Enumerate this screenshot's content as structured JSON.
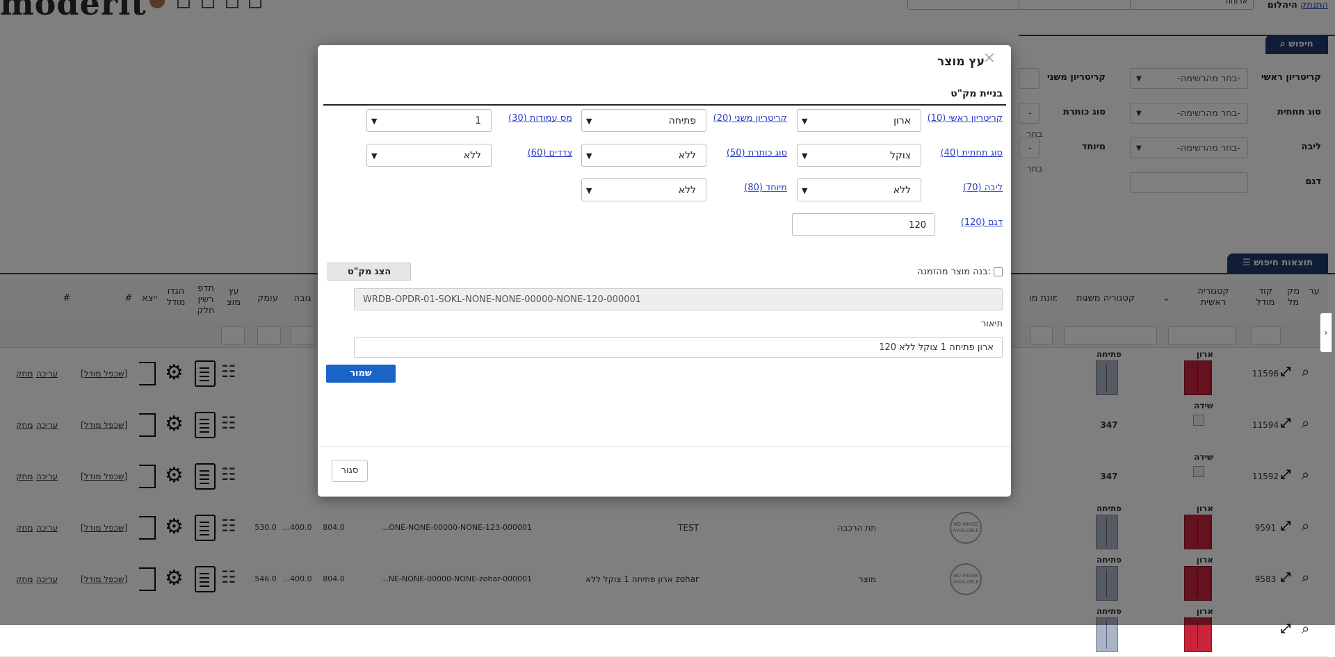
{
  "topbar": {
    "logo": "moderit",
    "links": [
      "היהלום",
      "התנתק"
    ],
    "boxes": [
      "ארונות",
      "",
      "",
      ""
    ]
  },
  "search_panel": {
    "tab_label": "חיפוש",
    "fields": [
      {
        "label": "קריטריון ראשי",
        "value": "-בחר מהרשימה-"
      },
      {
        "label": "קריטריון משני",
        "value": ""
      },
      {
        "label": "סוג תחתית",
        "value": "-בחר מהרשימה-"
      },
      {
        "label": "סוג כותרת",
        "value": "-בחר"
      },
      {
        "label": "ליבה",
        "value": "-בחר מהרשימה-"
      },
      {
        "label": "מיוחד",
        "value": "-בחר"
      },
      {
        "label": "דגם",
        "value": ""
      }
    ]
  },
  "results": {
    "tab_label": "תוצאות חיפוש",
    "headers": {
      "actions": "ער",
      "mk": "מק\nמל",
      "model_code": "קוד\nמודל",
      "main_cat": "קטגוריה\nראשית",
      "sub_cat": "קטגוריה משנית",
      "img": "תמונת מו",
      "depth": "עומק",
      "height": "גובה",
      "tree": "עץ\nמוצ",
      "parts": "תדפ\nרשין\nחלק",
      "settings": "הגדו\nמודל",
      "export": "ייצא",
      "hash1": "#",
      "hash2": "#"
    },
    "rows": [
      {
        "code": "11596",
        "main": "ארון",
        "sub": "פתיחה",
        "sub_value": "",
        "type": "",
        "desc": "",
        "sku": "",
        "h": "",
        "w": "",
        "d": "",
        "copy": "[שכפל מודל]",
        "edit": "עריכה",
        "del": "מחק"
      },
      {
        "code": "11594",
        "main": "שידה",
        "sub": "347",
        "sub_value": "",
        "type": "",
        "desc": "",
        "sku": "",
        "h": "",
        "w": "",
        "d": "",
        "copy": "[שכפל מודל]",
        "edit": "עריכה",
        "del": "מחק"
      },
      {
        "code": "11592",
        "main": "שידה",
        "sub": "347",
        "sub_value": "",
        "type": "",
        "desc": "",
        "sku": "",
        "h": "",
        "w": "",
        "d": "",
        "copy": "[שכפל מודל]",
        "edit": "עריכה",
        "del": "מחק"
      },
      {
        "code": "9591",
        "main": "ארון",
        "sub": "פתיחה",
        "type": "תת הרכבה",
        "desc": "TEST",
        "sku": "...ONE-NONE-00000-NONE-123-000001",
        "h": "804.0",
        "w": "...400.0",
        "d": "530.0",
        "copy": "[שכפל מודל]",
        "edit": "עריכה",
        "del": "מחק"
      },
      {
        "code": "9583",
        "main": "ארון",
        "sub": "פתיחה",
        "type": "מוצר",
        "desc": "ארון פתיחה 1 צוקל ללא zohar",
        "sku": "...NE-NONE-00000-NONE-zohar-000001",
        "h": "804.0",
        "w": "...400.0",
        "d": "546.0",
        "copy": "[שכפל מודל]",
        "edit": "עריכה",
        "del": "מחק"
      },
      {
        "code": "",
        "main": "ארון",
        "sub": "פתיחה",
        "type": "",
        "desc": "",
        "sku": "",
        "h": "",
        "w": "",
        "d": "",
        "copy": "",
        "edit": "",
        "del": ""
      }
    ],
    "noimage_text": "NO IMAGE AVAILABLE"
  },
  "modal": {
    "title": "עץ מוצר",
    "close_symbol": "×",
    "section_title": "בניית מק\"ט",
    "criteria": [
      {
        "label": "קריטריון ראשי (10)",
        "value": "ארון"
      },
      {
        "label": "קריטריון משני (20)",
        "value": "פתיחה"
      },
      {
        "label": "מס עמודות (30)",
        "value": "1"
      },
      {
        "label": "סוג תחתית (40)",
        "value": "צוקל"
      },
      {
        "label": "סוג כותרת (50)",
        "value": "ללא"
      },
      {
        "label": "צדדים (60)",
        "value": "ללא"
      },
      {
        "label": "ליבה (70)",
        "value": "ללא"
      },
      {
        "label": "מיוחד (80)",
        "value": "ללא"
      },
      {
        "label": "דגם (120)",
        "value": "120"
      }
    ],
    "build_from_order_label": "בנה מוצר מהזמנה:",
    "show_sku_button": "הצג מק\"ט",
    "sku_value": "WRDB-OPDR-01-SOKL-NONE-NONE-00000-NONE-120-000001",
    "description_label": "תיאור",
    "description_value": "ארון פתיחה 1 צוקל ללא 120",
    "save_button": "שמור",
    "close_button": "סגור"
  }
}
